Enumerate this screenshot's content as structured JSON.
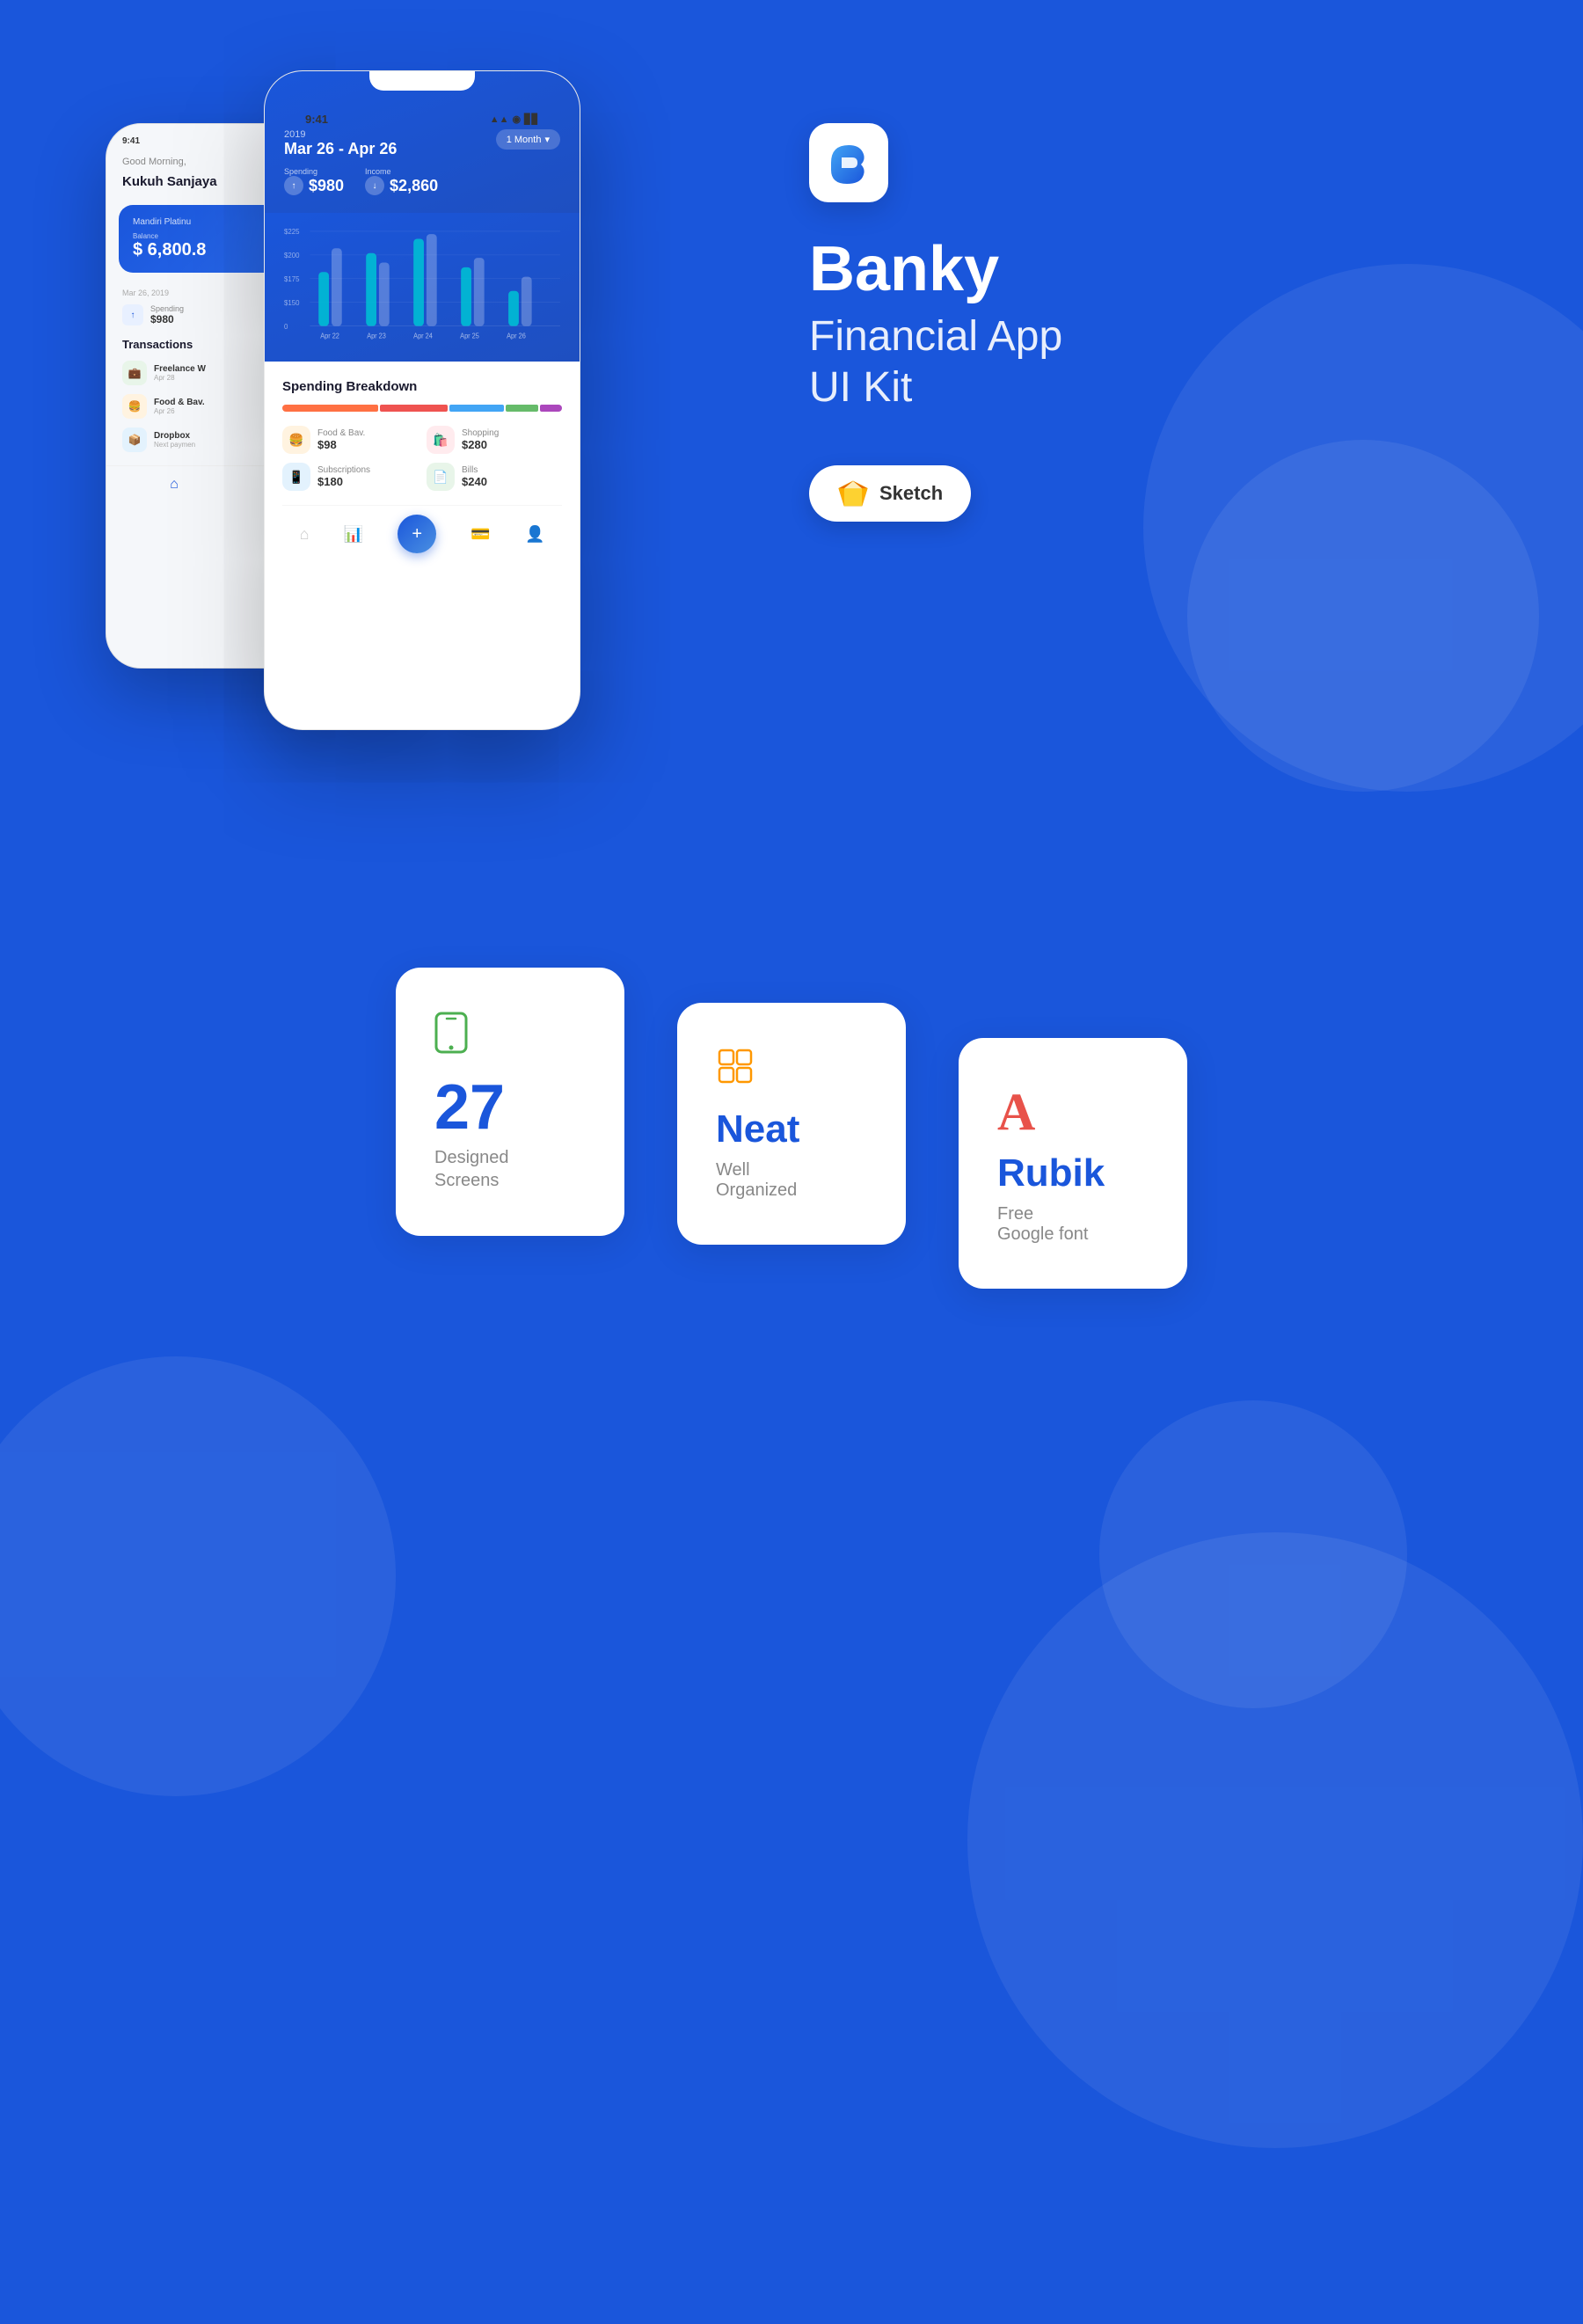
{
  "background_color": "#1a56db",
  "app": {
    "icon_letter": "B",
    "title": "Banky",
    "subtitle_line1": "Financial App",
    "subtitle_line2": "UI Kit",
    "sketch_label": "Sketch"
  },
  "back_phone": {
    "status_time": "9:41",
    "greeting": "Good Morning,",
    "user_name": "Kukuh Sanjaya",
    "card": {
      "name": "Mandiri Platinu",
      "balance_label": "Balance",
      "balance": "$ 6,800.8"
    },
    "date": "Mar 26, 2019",
    "spending": {
      "label": "Spending",
      "value": "$980"
    },
    "transactions_title": "Transactions",
    "transactions": [
      {
        "name": "Freelance W",
        "date": "Apr 28",
        "icon_bg": "#e8f5e9",
        "icon_color": "#4caf50",
        "icon": "💼"
      },
      {
        "name": "Food & Bav.",
        "date": "Apr 26",
        "icon_bg": "#fff3e0",
        "icon_color": "#ff9800",
        "icon": "🍔"
      },
      {
        "name": "Dropbox",
        "date": "Next paymen",
        "icon_bg": "#e3f2fd",
        "icon_color": "#2196f3",
        "icon": "📦"
      }
    ]
  },
  "front_phone": {
    "status_time": "9:41",
    "year": "2019",
    "date_range": "Mar 26 - Apr 26",
    "period": "1 Month",
    "spending": {
      "label": "Spending",
      "value": "$980",
      "arrow": "↑"
    },
    "income": {
      "label": "Income",
      "value": "$2,860",
      "arrow": "↓"
    },
    "chart": {
      "labels": [
        "Apr 22",
        "Apr 23",
        "Apr 24",
        "Apr 25",
        "Apr 26"
      ],
      "y_labels": [
        "$225",
        "$200",
        "$175",
        "$150",
        "0"
      ]
    },
    "breakdown": {
      "title": "Spending Breakdown",
      "bar": [
        {
          "color": "#ff7043",
          "width": 35
        },
        {
          "color": "#ef5350",
          "width": 25
        },
        {
          "color": "#42a5f5",
          "width": 20
        },
        {
          "color": "#66bb6a",
          "width": 12
        },
        {
          "color": "#ab47bc",
          "width": 8
        }
      ],
      "items": [
        {
          "label": "Food & Bav.",
          "value": "$98",
          "icon_bg": "#fff3e0",
          "icon": "🍔"
        },
        {
          "label": "Shopping",
          "value": "$280",
          "icon_bg": "#ffebee",
          "icon": "🛍️"
        },
        {
          "label": "Subscriptions",
          "value": "$180",
          "icon_bg": "#e3f2fd",
          "icon": "📱"
        },
        {
          "label": "Bills",
          "value": "$240",
          "icon_bg": "#e8f5e9",
          "icon": "📄"
        }
      ]
    }
  },
  "features": [
    {
      "id": "screens",
      "icon_type": "phone",
      "number": "27",
      "desc_line1": "Designed",
      "desc_line2": "Screens"
    },
    {
      "id": "neat",
      "icon_type": "layers",
      "title": "Neat",
      "subtitle_line1": "Well",
      "subtitle_line2": "Organized"
    },
    {
      "id": "font",
      "icon_type": "letter-A",
      "font_name": "Rubik",
      "font_desc_line1": "Free",
      "font_desc_line2": "Google font"
    }
  ]
}
